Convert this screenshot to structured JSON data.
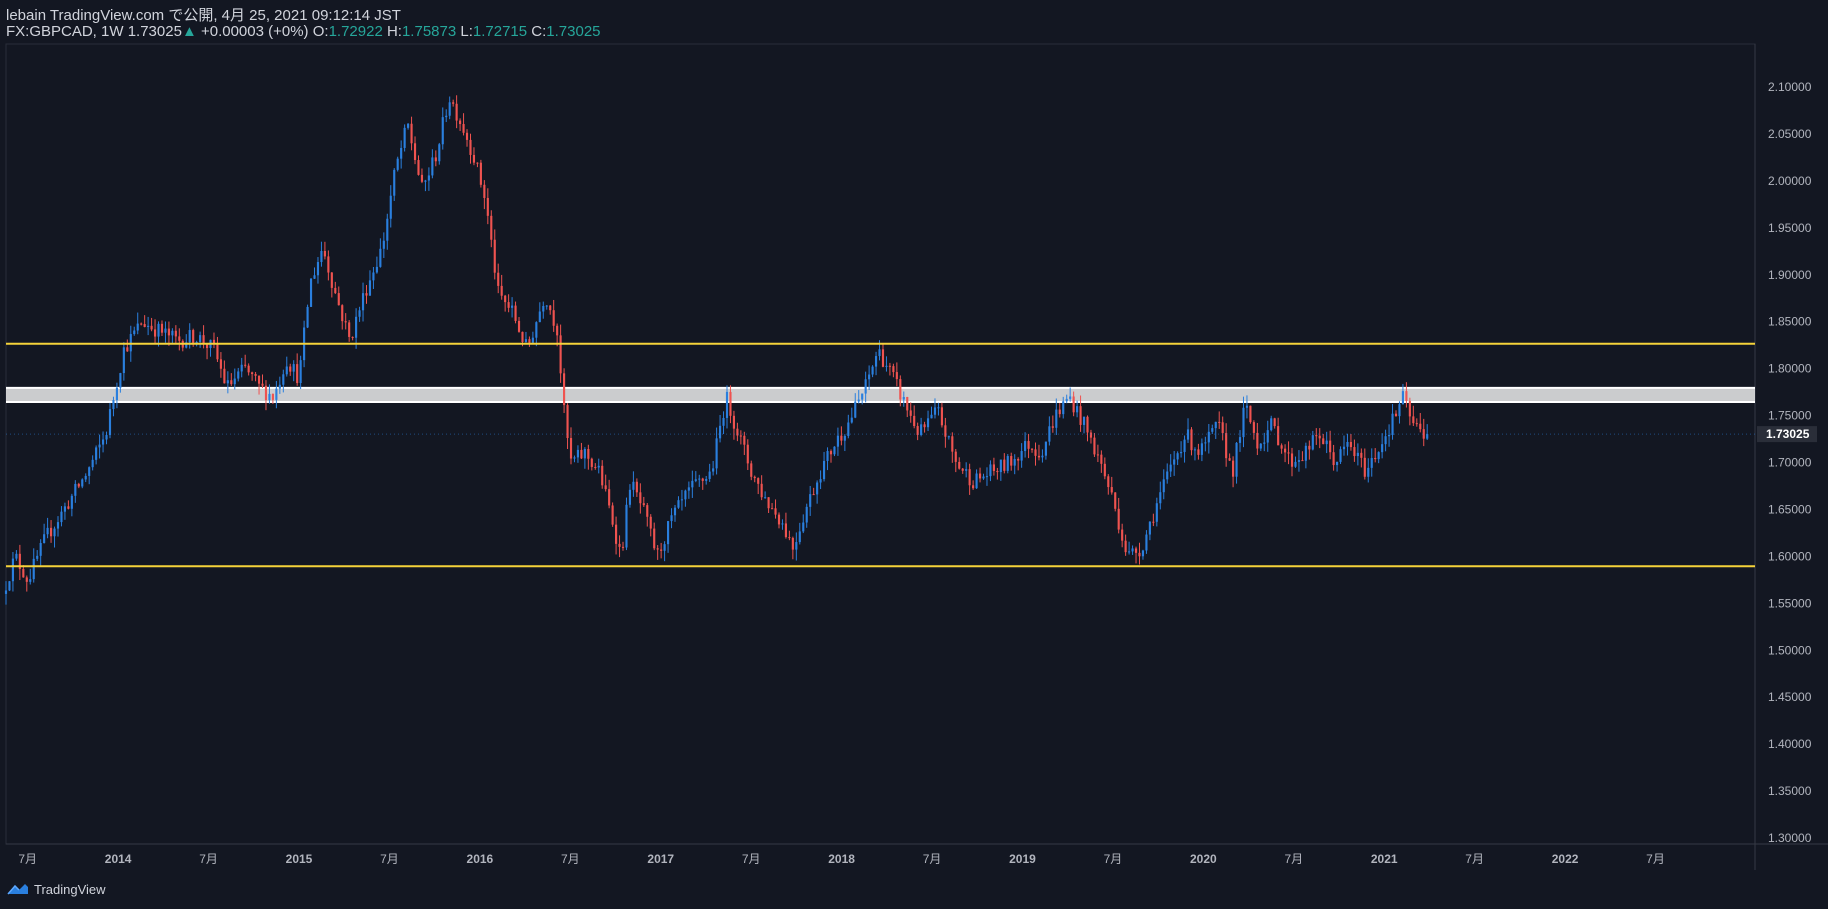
{
  "header": {
    "publish_line": "lebain TradingView.com で公開, 4月 25, 2021 09:12:14 JST",
    "symbol": "FX:GBPCAD, 1W",
    "last": "1.73025",
    "change_arrow": "▲",
    "change": "+0.00003 (+0%)",
    "o_label": "O:",
    "o_value": "1.72922",
    "h_label": "H:",
    "h_value": "1.75873",
    "l_label": "L:",
    "l_value": "1.72715",
    "c_label": "C:",
    "c_value": "1.73025"
  },
  "footer": {
    "brand": "TradingView",
    "logo_icon": "tradingview-logo-icon"
  },
  "colors": {
    "background": "#131722",
    "up": "#2a7fde",
    "down": "#ef5350",
    "support_resistance": "#f5d33a",
    "zone": "#ffffff",
    "price_tag": "#2a2e39"
  },
  "chart_data": {
    "type": "candlestick",
    "symbol": "FX:GBPCAD",
    "interval": "1W",
    "ylim": [
      1.3,
      2.1
    ],
    "y_ticks": [
      "2.10000",
      "2.05000",
      "2.00000",
      "1.95000",
      "1.90000",
      "1.85000",
      "1.80000",
      "1.75000",
      "1.70000",
      "1.65000",
      "1.60000",
      "1.55000",
      "1.50000",
      "1.45000",
      "1.40000",
      "1.35000",
      "1.30000"
    ],
    "x_ticks": [
      "7月",
      "2014",
      "7月",
      "2015",
      "7月",
      "2016",
      "7月",
      "2017",
      "7月",
      "2018",
      "7月",
      "2019",
      "7月",
      "2020",
      "7月",
      "2021",
      "7月",
      "2022",
      "7月"
    ],
    "x_tick_dates": [
      2013.5,
      2014.0,
      2014.5,
      2015.0,
      2015.5,
      2016.0,
      2016.5,
      2017.0,
      2017.5,
      2018.0,
      2018.5,
      2019.0,
      2019.5,
      2020.0,
      2020.5,
      2021.0,
      2021.5,
      2022.0,
      2022.5
    ],
    "x_range": [
      2013.38,
      2023.05
    ],
    "last_price_label": "1.73025",
    "last_price": 1.73025,
    "horizontal_lines": [
      {
        "name": "resistance",
        "value": 1.8265
      },
      {
        "name": "support",
        "value": 1.5895
      }
    ],
    "zone": {
      "top": 1.7795,
      "bottom": 1.7645
    },
    "price_path": [
      [
        2013.38,
        1.56
      ],
      [
        2013.45,
        1.6
      ],
      [
        2013.52,
        1.575
      ],
      [
        2013.62,
        1.62
      ],
      [
        2013.72,
        1.65
      ],
      [
        2013.85,
        1.69
      ],
      [
        2013.95,
        1.73
      ],
      [
        2014.05,
        1.82
      ],
      [
        2014.15,
        1.85
      ],
      [
        2014.25,
        1.84
      ],
      [
        2014.35,
        1.83
      ],
      [
        2014.45,
        1.835
      ],
      [
        2014.55,
        1.82
      ],
      [
        2014.62,
        1.78
      ],
      [
        2014.72,
        1.8
      ],
      [
        2014.8,
        1.78
      ],
      [
        2014.88,
        1.77
      ],
      [
        2014.95,
        1.81
      ],
      [
        2015.02,
        1.79
      ],
      [
        2015.08,
        1.89
      ],
      [
        2015.15,
        1.93
      ],
      [
        2015.22,
        1.88
      ],
      [
        2015.3,
        1.83
      ],
      [
        2015.38,
        1.88
      ],
      [
        2015.48,
        1.93
      ],
      [
        2015.55,
        2.01
      ],
      [
        2015.62,
        2.06
      ],
      [
        2015.7,
        1.99
      ],
      [
        2015.78,
        2.03
      ],
      [
        2015.85,
        2.09
      ],
      [
        2015.92,
        2.06
      ],
      [
        2015.98,
        2.03
      ],
      [
        2016.05,
        1.98
      ],
      [
        2016.12,
        1.88
      ],
      [
        2016.2,
        1.86
      ],
      [
        2016.28,
        1.82
      ],
      [
        2016.38,
        1.88
      ],
      [
        2016.45,
        1.84
      ],
      [
        2016.48,
        1.76
      ],
      [
        2016.52,
        1.7
      ],
      [
        2016.6,
        1.71
      ],
      [
        2016.68,
        1.69
      ],
      [
        2016.75,
        1.64
      ],
      [
        2016.8,
        1.6
      ],
      [
        2016.85,
        1.68
      ],
      [
        2016.92,
        1.65
      ],
      [
        2017.0,
        1.6
      ],
      [
        2017.08,
        1.64
      ],
      [
        2017.18,
        1.67
      ],
      [
        2017.3,
        1.69
      ],
      [
        2017.38,
        1.77
      ],
      [
        2017.45,
        1.73
      ],
      [
        2017.52,
        1.69
      ],
      [
        2017.6,
        1.66
      ],
      [
        2017.68,
        1.64
      ],
      [
        2017.75,
        1.61
      ],
      [
        2017.82,
        1.65
      ],
      [
        2017.9,
        1.69
      ],
      [
        2017.98,
        1.72
      ],
      [
        2018.05,
        1.74
      ],
      [
        2018.15,
        1.78
      ],
      [
        2018.22,
        1.82
      ],
      [
        2018.28,
        1.8
      ],
      [
        2018.35,
        1.77
      ],
      [
        2018.45,
        1.73
      ],
      [
        2018.55,
        1.755
      ],
      [
        2018.65,
        1.7
      ],
      [
        2018.75,
        1.68
      ],
      [
        2018.85,
        1.69
      ],
      [
        2018.95,
        1.7
      ],
      [
        2019.05,
        1.72
      ],
      [
        2019.12,
        1.71
      ],
      [
        2019.2,
        1.75
      ],
      [
        2019.28,
        1.77
      ],
      [
        2019.36,
        1.74
      ],
      [
        2019.45,
        1.7
      ],
      [
        2019.52,
        1.66
      ],
      [
        2019.6,
        1.6
      ],
      [
        2019.68,
        1.61
      ],
      [
        2019.75,
        1.65
      ],
      [
        2019.85,
        1.7
      ],
      [
        2019.92,
        1.73
      ],
      [
        2020.0,
        1.71
      ],
      [
        2020.1,
        1.74
      ],
      [
        2020.18,
        1.69
      ],
      [
        2020.25,
        1.76
      ],
      [
        2020.32,
        1.72
      ],
      [
        2020.4,
        1.74
      ],
      [
        2020.5,
        1.7
      ],
      [
        2020.58,
        1.71
      ],
      [
        2020.66,
        1.73
      ],
      [
        2020.75,
        1.7
      ],
      [
        2020.82,
        1.72
      ],
      [
        2020.92,
        1.69
      ],
      [
        2021.0,
        1.72
      ],
      [
        2021.08,
        1.75
      ],
      [
        2021.12,
        1.77
      ],
      [
        2021.18,
        1.74
      ],
      [
        2021.25,
        1.73
      ]
    ]
  }
}
